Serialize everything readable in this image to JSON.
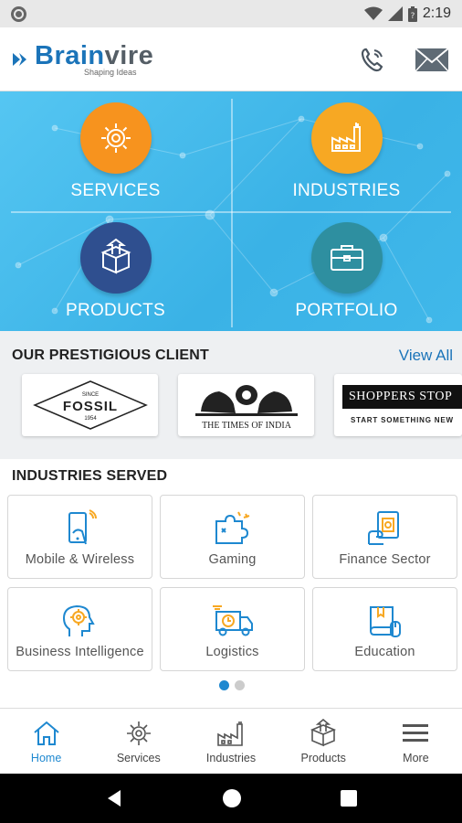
{
  "status_bar": {
    "time": "2:19"
  },
  "header": {
    "brand_part1": "Brain",
    "brand_part2": "vire",
    "tagline": "Shaping Ideas",
    "call_icon": "phone-icon",
    "mail_icon": "mail-icon"
  },
  "hero": {
    "tiles": [
      {
        "label": "SERVICES",
        "icon": "gear-icon",
        "color": "#f7931e"
      },
      {
        "label": "INDUSTRIES",
        "icon": "factory-icon",
        "color": "#f7a823"
      },
      {
        "label": "PRODUCTS",
        "icon": "box-icon",
        "color": "#2f4f8f"
      },
      {
        "label": "PORTFOLIO",
        "icon": "briefcase-icon",
        "color": "#2e8fa0"
      }
    ]
  },
  "clients": {
    "title": "OUR PRESTIGIOUS CLIENT",
    "view_all": "View All",
    "logos": [
      {
        "name": "FOSSIL",
        "top": "SINCE",
        "bottom": "1954"
      },
      {
        "name": "THE TIMES OF INDIA"
      },
      {
        "name": "SHOPPERS STOP",
        "tagline": "START SOMETHING NEW"
      }
    ]
  },
  "industries": {
    "title": "INDUSTRIES SERVED",
    "items": [
      {
        "label": "Mobile & Wireless",
        "icon": "mobile-icon"
      },
      {
        "label": "Gaming",
        "icon": "puzzle-icon"
      },
      {
        "label": "Finance Sector",
        "icon": "money-icon"
      },
      {
        "label": "Business Intelligence",
        "icon": "brain-gear-icon"
      },
      {
        "label": "Logistics",
        "icon": "truck-icon"
      },
      {
        "label": "Education",
        "icon": "book-icon"
      }
    ],
    "page_current": 1,
    "page_count": 2
  },
  "bottom_nav": [
    {
      "label": "Home",
      "icon": "home-icon",
      "active": true
    },
    {
      "label": "Services",
      "icon": "gear-icon",
      "active": false
    },
    {
      "label": "Industries",
      "icon": "factory-icon",
      "active": false
    },
    {
      "label": "Products",
      "icon": "box-icon",
      "active": false
    },
    {
      "label": "More",
      "icon": "menu-icon",
      "active": false
    }
  ],
  "colors": {
    "brand_blue": "#1b74b9",
    "hero_blue": "#45bcee",
    "active_nav": "#1e88d0"
  }
}
